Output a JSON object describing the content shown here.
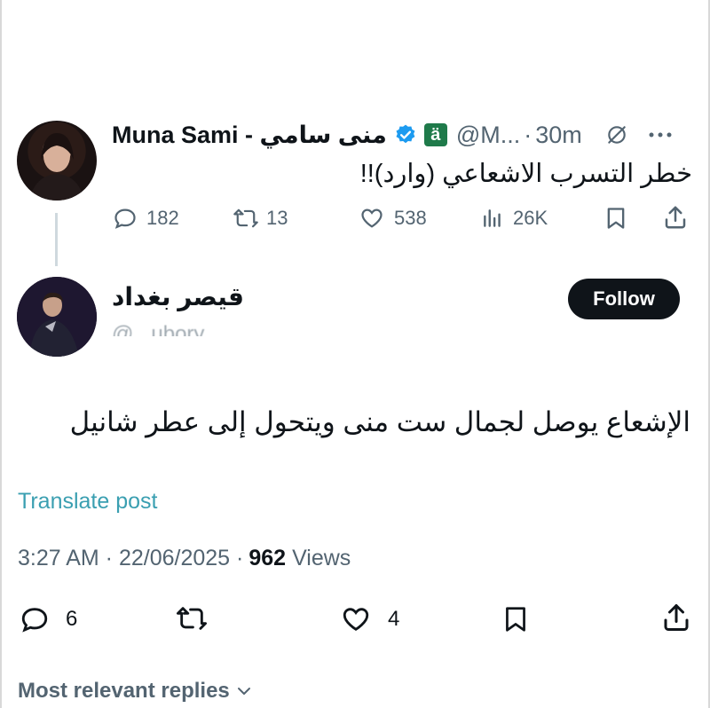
{
  "quoted_post": {
    "author_name": "Muna Sami - منى سامي",
    "handle": "@M...",
    "separator": "·",
    "time": "30m",
    "text": "خطر التسرب الاشعاعي (وارد)!!",
    "badge_glyph": "ä",
    "stats": {
      "replies": "182",
      "reposts": "13",
      "likes": "538",
      "views": "26K"
    }
  },
  "reply_post": {
    "author_name": "قيصر بغداد",
    "handle_partial": "@...ubory",
    "follow_label": "Follow",
    "text": "الإشعاع يوصل لجمال ست منى ويتحول إلى عطر شانيل",
    "translate_label": "Translate post",
    "timestamp": "3:27 AM · 22/06/2025 ·",
    "views_count": "962",
    "views_label": "Views",
    "stats": {
      "replies": "6",
      "likes": "4"
    }
  },
  "replies_filter": {
    "label": "Most relevant replies"
  },
  "colors": {
    "verified": "#1d9bf0",
    "badge_bg": "#1f7a4a",
    "follow_bg": "#0f1419",
    "link": "#1d9bf0",
    "muted": "#536471"
  }
}
